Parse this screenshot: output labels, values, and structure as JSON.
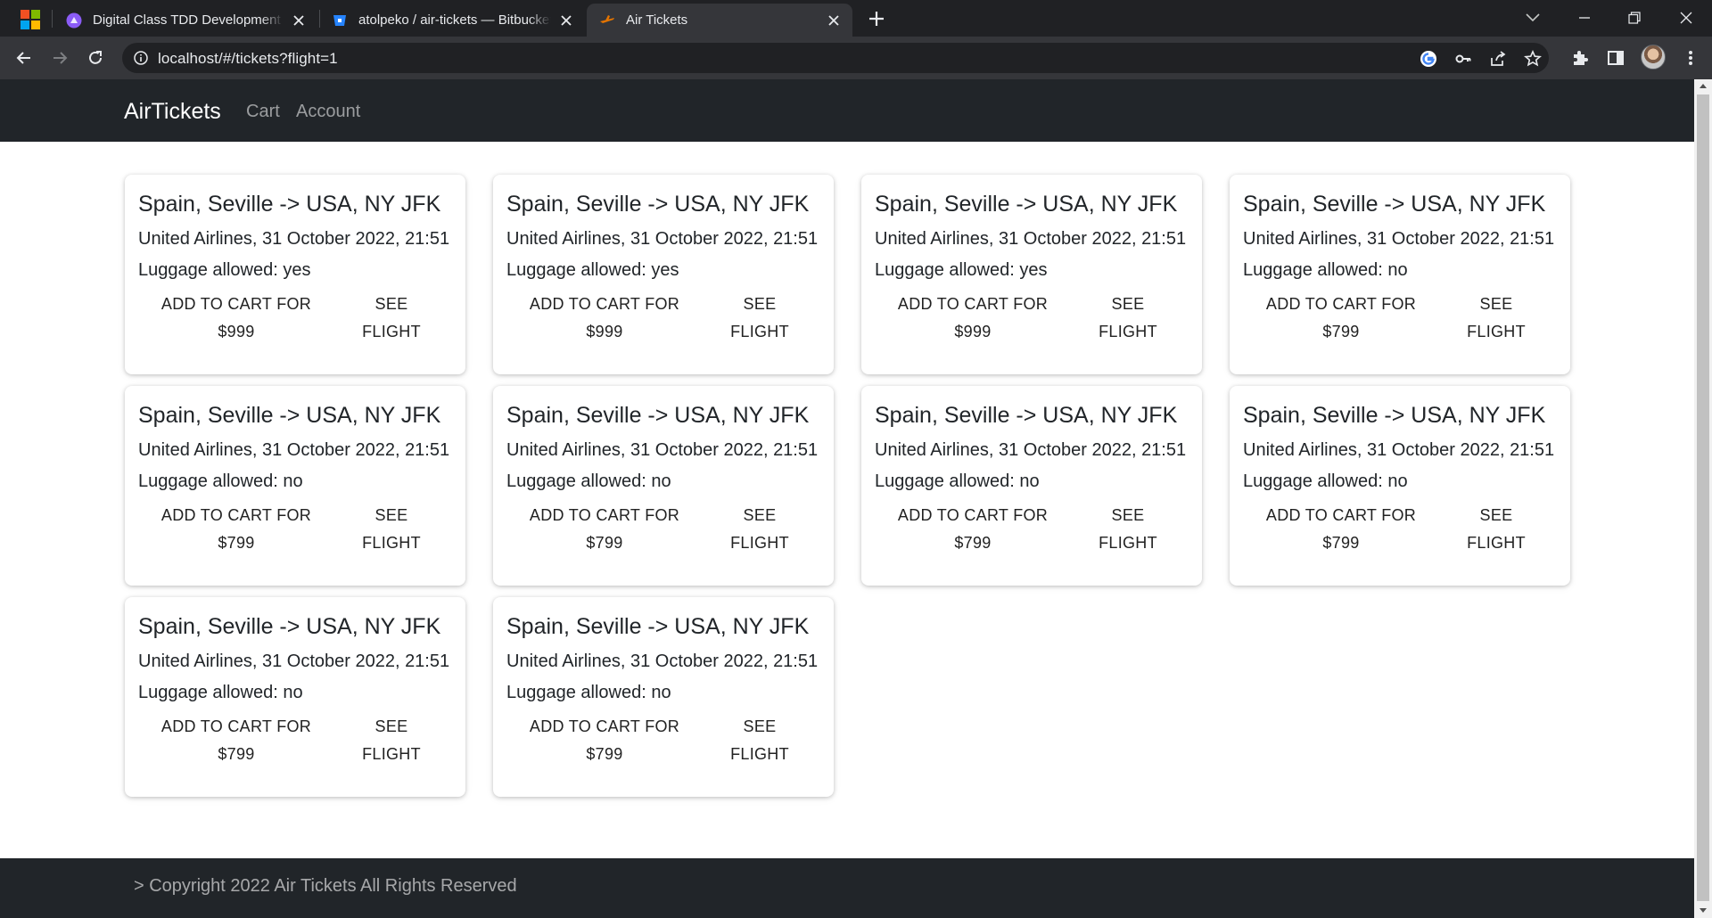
{
  "browser": {
    "tabs": [
      {
        "title": "Digital Class TDD Development A",
        "active": false,
        "icon": "digital-class-icon"
      },
      {
        "title": "atolpeko / air-tickets — Bitbucket",
        "active": false,
        "icon": "bitbucket-icon"
      },
      {
        "title": "Air Tickets",
        "active": true,
        "icon": "air-tickets-icon"
      }
    ],
    "url": "localhost/#/tickets?flight=1"
  },
  "app": {
    "brand": "AirTickets",
    "nav": {
      "cart": "Cart",
      "account": "Account"
    },
    "footer": "> Copyright 2022 Air Tickets All Rights Reserved"
  },
  "tickets": [
    {
      "route": "Spain, Seville -> USA, NY JFK",
      "details": "United Airlines, 31 October 2022, 21:51",
      "luggage": "Luggage allowed: yes",
      "add_label": "ADD TO CART FOR",
      "price": "$999",
      "see_label": "SEE",
      "see_label_2": "FLIGHT"
    },
    {
      "route": "Spain, Seville -> USA, NY JFK",
      "details": "United Airlines, 31 October 2022, 21:51",
      "luggage": "Luggage allowed: yes",
      "add_label": "ADD TO CART FOR",
      "price": "$999",
      "see_label": "SEE",
      "see_label_2": "FLIGHT"
    },
    {
      "route": "Spain, Seville -> USA, NY JFK",
      "details": "United Airlines, 31 October 2022, 21:51",
      "luggage": "Luggage allowed: yes",
      "add_label": "ADD TO CART FOR",
      "price": "$999",
      "see_label": "SEE",
      "see_label_2": "FLIGHT"
    },
    {
      "route": "Spain, Seville -> USA, NY JFK",
      "details": "United Airlines, 31 October 2022, 21:51",
      "luggage": "Luggage allowed: no",
      "add_label": "ADD TO CART FOR",
      "price": "$799",
      "see_label": "SEE",
      "see_label_2": "FLIGHT"
    },
    {
      "route": "Spain, Seville -> USA, NY JFK",
      "details": "United Airlines, 31 October 2022, 21:51",
      "luggage": "Luggage allowed: no",
      "add_label": "ADD TO CART FOR",
      "price": "$799",
      "see_label": "SEE",
      "see_label_2": "FLIGHT"
    },
    {
      "route": "Spain, Seville -> USA, NY JFK",
      "details": "United Airlines, 31 October 2022, 21:51",
      "luggage": "Luggage allowed: no",
      "add_label": "ADD TO CART FOR",
      "price": "$799",
      "see_label": "SEE",
      "see_label_2": "FLIGHT"
    },
    {
      "route": "Spain, Seville -> USA, NY JFK",
      "details": "United Airlines, 31 October 2022, 21:51",
      "luggage": "Luggage allowed: no",
      "add_label": "ADD TO CART FOR",
      "price": "$799",
      "see_label": "SEE",
      "see_label_2": "FLIGHT"
    },
    {
      "route": "Spain, Seville -> USA, NY JFK",
      "details": "United Airlines, 31 October 2022, 21:51",
      "luggage": "Luggage allowed: no",
      "add_label": "ADD TO CART FOR",
      "price": "$799",
      "see_label": "SEE",
      "see_label_2": "FLIGHT"
    },
    {
      "route": "Spain, Seville -> USA, NY JFK",
      "details": "United Airlines, 31 October 2022, 21:51",
      "luggage": "Luggage allowed: no",
      "add_label": "ADD TO CART FOR",
      "price": "$799",
      "see_label": "SEE",
      "see_label_2": "FLIGHT"
    },
    {
      "route": "Spain, Seville -> USA, NY JFK",
      "details": "United Airlines, 31 October 2022, 21:51",
      "luggage": "Luggage allowed: no",
      "add_label": "ADD TO CART FOR",
      "price": "$799",
      "see_label": "SEE",
      "see_label_2": "FLIGHT"
    }
  ],
  "colors": {
    "navbar": "#212529",
    "chrome_tabbar": "#202124",
    "chrome_toolbar": "#35363a",
    "text": "#212529"
  }
}
